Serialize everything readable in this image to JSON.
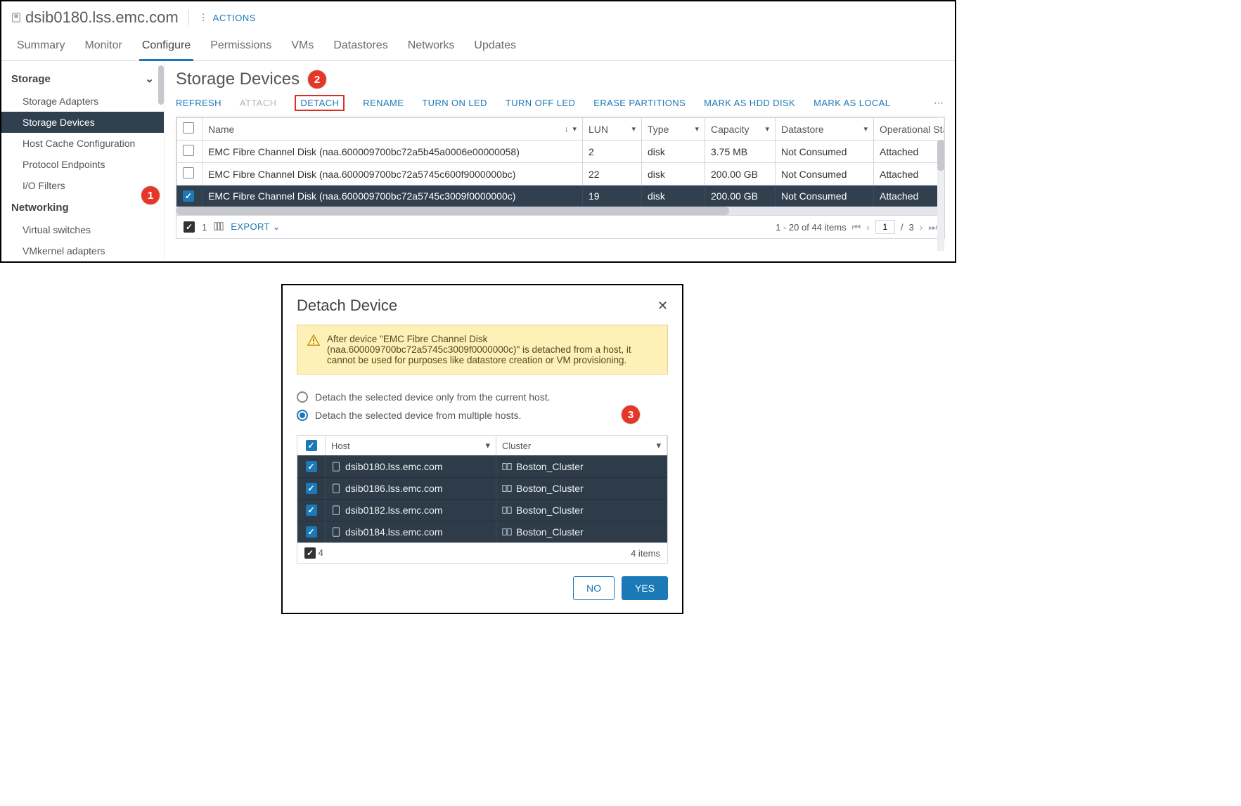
{
  "header": {
    "host": "dsib0180.lss.emc.com",
    "actions_label": "ACTIONS"
  },
  "tabs": {
    "items": [
      "Summary",
      "Monitor",
      "Configure",
      "Permissions",
      "VMs",
      "Datastores",
      "Networks",
      "Updates"
    ],
    "active": "Configure"
  },
  "sidebar": {
    "groups": [
      {
        "title": "Storage",
        "items": [
          "Storage Adapters",
          "Storage Devices",
          "Host Cache Configuration",
          "Protocol Endpoints",
          "I/O Filters"
        ],
        "selected": "Storage Devices"
      },
      {
        "title": "Networking",
        "items": [
          "Virtual switches",
          "VMkernel adapters"
        ]
      }
    ]
  },
  "main": {
    "title": "Storage Devices",
    "toolbar": {
      "refresh": "REFRESH",
      "attach": "ATTACH",
      "detach": "DETACH",
      "rename": "RENAME",
      "turn_on_led": "TURN ON LED",
      "turn_off_led": "TURN OFF LED",
      "erase_partitions": "ERASE PARTITIONS",
      "mark_hdd": "MARK AS HDD DISK",
      "mark_local": "MARK AS LOCAL"
    },
    "columns": {
      "name": "Name",
      "lun": "LUN",
      "type": "Type",
      "capacity": "Capacity",
      "datastore": "Datastore",
      "opstate": "Operational State"
    },
    "rows": [
      {
        "checked": false,
        "name": "EMC Fibre Channel Disk (naa.600009700bc72a5b45a0006e00000058)",
        "lun": "2",
        "type": "disk",
        "capacity": "3.75 MB",
        "datastore": "Not Consumed",
        "opstate": "Attached"
      },
      {
        "checked": false,
        "name": "EMC Fibre Channel Disk (naa.600009700bc72a5745c600f9000000bc)",
        "lun": "22",
        "type": "disk",
        "capacity": "200.00 GB",
        "datastore": "Not Consumed",
        "opstate": "Attached"
      },
      {
        "checked": true,
        "name": "EMC Fibre Channel Disk (naa.600009700bc72a5745c3009f0000000c)",
        "lun": "19",
        "type": "disk",
        "capacity": "200.00 GB",
        "datastore": "Not Consumed",
        "opstate": "Attached"
      }
    ],
    "footer": {
      "selected_count": "1",
      "export_label": "EXPORT",
      "range": "1 - 20 of 44 items",
      "page": "1",
      "pages": "3"
    }
  },
  "annotations": {
    "a1": "1",
    "a2": "2",
    "a3": "3"
  },
  "dialog": {
    "title": "Detach Device",
    "warning": "After device \"EMC Fibre Channel Disk (naa.600009700bc72a5745c3009f0000000c)\" is detached from a host, it cannot be used for purposes like datastore creation or VM provisioning.",
    "radio_current": "Detach the selected device only from the current host.",
    "radio_multi": "Detach the selected device from multiple hosts.",
    "radio_selected": "multi",
    "hosts": {
      "columns": {
        "host": "Host",
        "cluster": "Cluster"
      },
      "rows": [
        {
          "host": "dsib0180.lss.emc.com",
          "cluster": "Boston_Cluster"
        },
        {
          "host": "dsib0186.lss.emc.com",
          "cluster": "Boston_Cluster"
        },
        {
          "host": "dsib0182.lss.emc.com",
          "cluster": "Boston_Cluster"
        },
        {
          "host": "dsib0184.lss.emc.com",
          "cluster": "Boston_Cluster"
        }
      ],
      "selected_count": "4",
      "total_label": "4 items"
    },
    "buttons": {
      "no": "NO",
      "yes": "YES"
    }
  }
}
